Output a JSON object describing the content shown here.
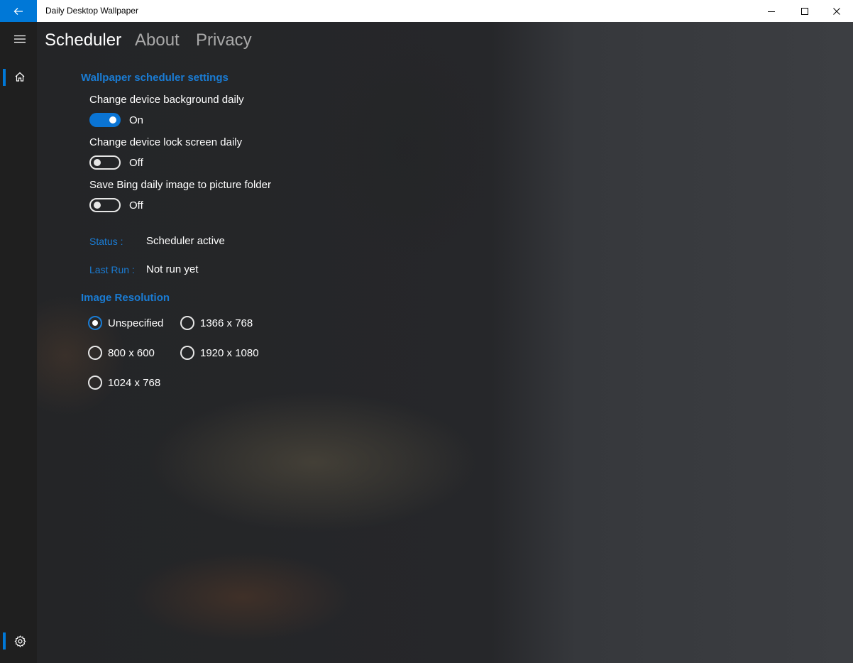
{
  "titlebar": {
    "back_icon": "arrow-left-icon",
    "title": "Daily Desktop Wallpaper",
    "controls": [
      "minimize-icon",
      "maximize-icon",
      "close-icon"
    ],
    "accent": "#0078d7"
  },
  "rail": {
    "hamburger_icon": "hamburger-menu-icon",
    "home_icon": "home-icon",
    "settings_icon": "gear-icon"
  },
  "tabs": [
    {
      "label": "Scheduler",
      "selected": true
    },
    {
      "label": "About",
      "selected": false
    },
    {
      "label": "Privacy",
      "selected": false
    }
  ],
  "scheduler": {
    "heading": "Wallpaper scheduler settings",
    "toggles": [
      {
        "label": "Change device background daily",
        "state": "On"
      },
      {
        "label": "Change device lock screen daily",
        "state": "Off"
      },
      {
        "label": "Save Bing daily image to picture folder",
        "state": "Off"
      }
    ],
    "status_key": "Status :",
    "status_value": "Scheduler active",
    "lastrun_key": "Last Run :",
    "lastrun_value": "Not run yet"
  },
  "resolution": {
    "heading": "Image Resolution",
    "options": [
      "Unspecified",
      "1366 x 768",
      "800 x 600",
      "1920 x 1080",
      "1024 x 768"
    ],
    "selected": "Unspecified"
  },
  "colors": {
    "accent": "#0078d7",
    "link_blue": "#1a7cd4"
  }
}
